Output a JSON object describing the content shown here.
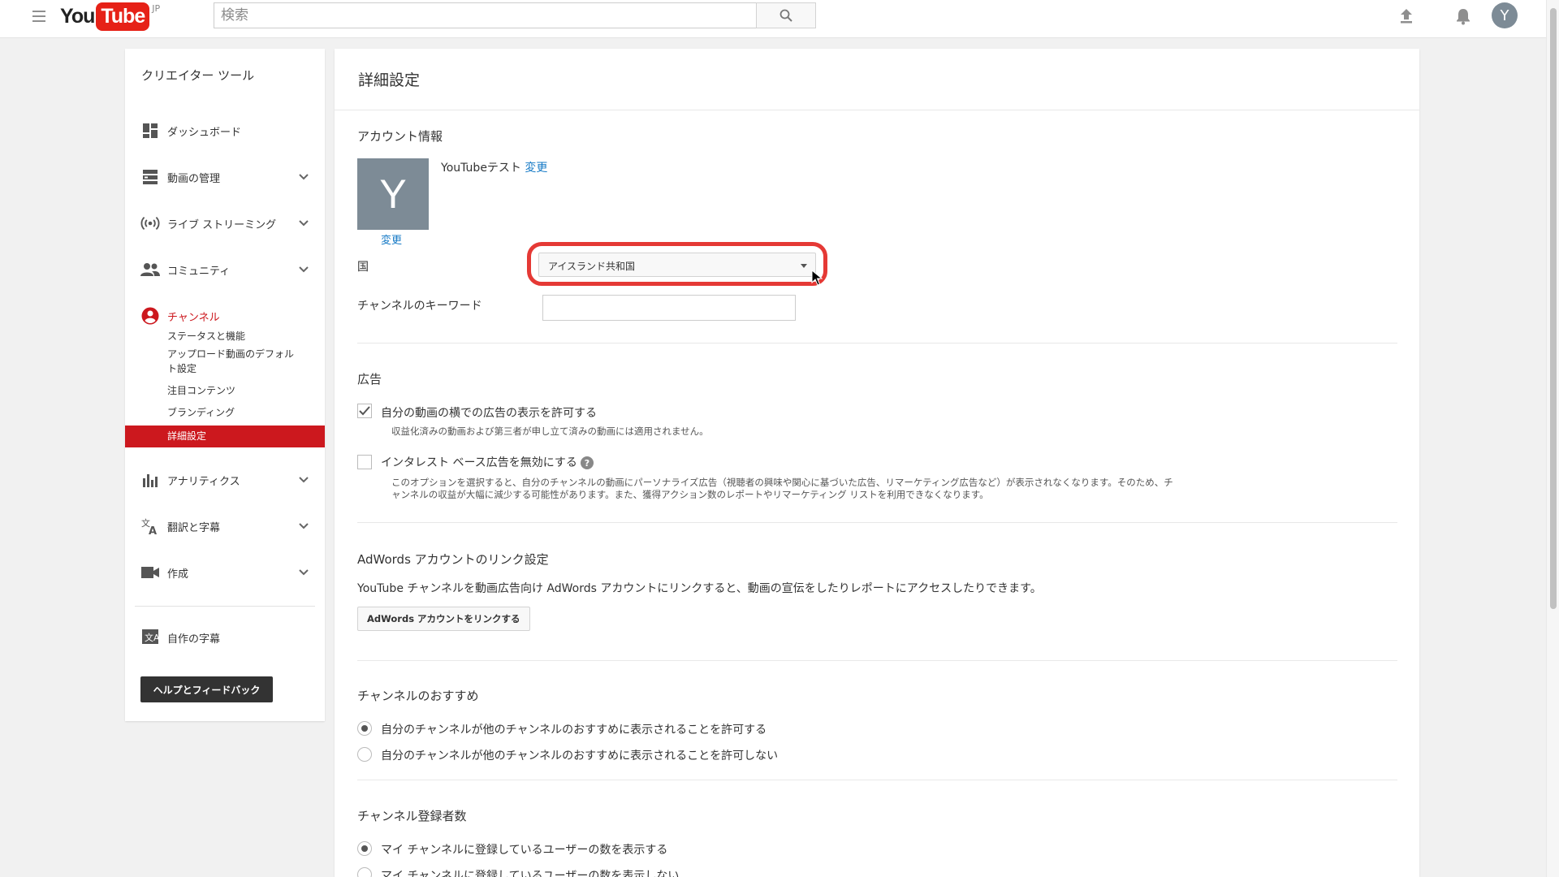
{
  "topbar": {
    "logo_you": "You",
    "logo_tube": "Tube",
    "logo_region": "JP",
    "search_placeholder": "検索",
    "avatar_letter": "Y"
  },
  "sidebar": {
    "title": "クリエイター ツール",
    "items": [
      {
        "label": "ダッシュボード",
        "icon": "dashboard-icon"
      },
      {
        "label": "動画の管理",
        "icon": "video-manager-icon"
      },
      {
        "label": "ライブ ストリーミング",
        "icon": "live-streaming-icon"
      },
      {
        "label": "コミュニティ",
        "icon": "community-icon"
      },
      {
        "label": "チャンネル",
        "icon": "channel-icon"
      },
      {
        "label": "アナリティクス",
        "icon": "analytics-icon"
      },
      {
        "label": "翻訳と字幕",
        "icon": "translate-icon"
      },
      {
        "label": "作成",
        "icon": "create-icon"
      },
      {
        "label": "自作の字幕",
        "icon": "subtitles-icon"
      }
    ],
    "channel_sub": [
      {
        "label": "ステータスと機能"
      },
      {
        "label": "アップロード動画のデフォルト設定"
      },
      {
        "label": "注目コンテンツ"
      },
      {
        "label": "ブランディング"
      },
      {
        "label": "詳細設定"
      }
    ],
    "help_button": "ヘルプとフィードバック"
  },
  "main": {
    "page_title": "詳細設定",
    "account": {
      "section_title": "アカウント情報",
      "avatar_letter": "Y",
      "name": "YouTubeテスト",
      "change_link": "変更",
      "avatar_change_link": "変更",
      "country_label": "国",
      "country_value": "アイスランド共和国",
      "keywords_label": "チャンネルのキーワード",
      "keywords_value": ""
    },
    "ads": {
      "section_title": "広告",
      "option1_label": "自分の動画の横での広告の表示を許可する",
      "option1_checked": true,
      "option1_note": "収益化済みの動画および第三者が申し立て済みの動画には適用されません。",
      "option2_label": "インタレスト ベース広告を無効にする",
      "option2_checked": false,
      "option2_note_line1": "このオプションを選択すると、自分のチャンネルの動画にパーソナライズ広告（視聴者の興味や関心に基づいた広告、リマーケティング広告など）が表示されなくなります。そのため、チ",
      "option2_note_line2": "ャンネルの収益が大幅に減少する可能性があります。また、獲得アクション数のレポートやリマーケティング リストを利用できなくなります。"
    },
    "adwords": {
      "section_title": "AdWords アカウントのリンク設定",
      "description": "YouTube チャンネルを動画広告向け AdWords アカウントにリンクすると、動画の宣伝をしたりレポートにアクセスしたりできます。",
      "button_label": "AdWords アカウントをリンクする"
    },
    "recommend": {
      "section_title": "チャンネルのおすすめ",
      "option_allow": "自分のチャンネルが他のチャンネルのおすすめに表示されることを許可する",
      "option_deny": "自分のチャンネルが他のチャンネルのおすすめに表示されることを許可しない",
      "selected": "allow"
    },
    "subscribers": {
      "section_title": "チャンネル登録者数",
      "option_show": "マイ チャンネルに登録しているユーザーの数を表示する",
      "option_hide": "マイ チャンネルに登録しているユーザーの数を表示しない",
      "selected": "show"
    }
  },
  "colors": {
    "brand_red": "#cc181e",
    "highlight_red": "#e53935",
    "link_blue": "#167ac6",
    "avatar_gray": "#7d8b96"
  }
}
